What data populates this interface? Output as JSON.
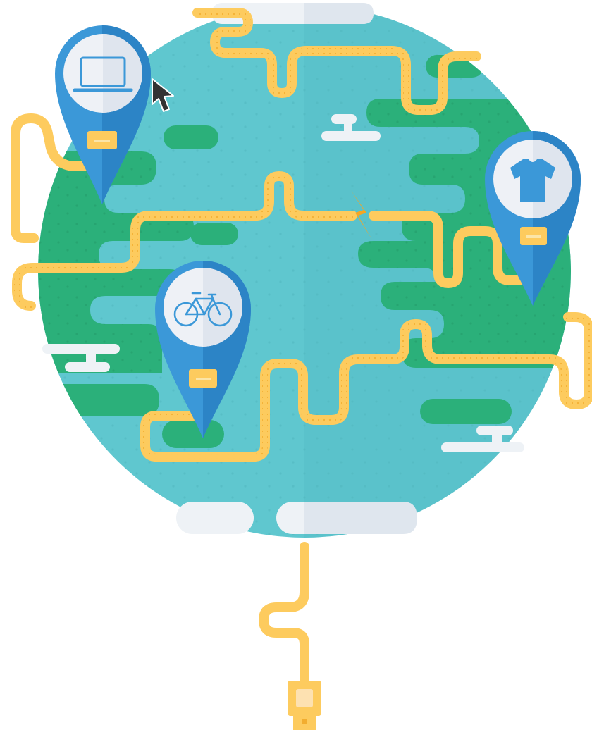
{
  "illustration": {
    "subject": "globe-connected-by-cable",
    "palette": {
      "ocean": "#5FC7CF",
      "ocean_dark": "#56BDC5",
      "land": "#2BB07A",
      "cable": "#FDCB5E",
      "cable_dots": "#F6B940",
      "pin_blue": "#3B98D8",
      "pin_blue_dark": "#2C84C6",
      "pin_face": "#EEF1F6",
      "cloud": "#EEF2F6",
      "spark": "#F5A623",
      "cursor": "#333333"
    },
    "pins": [
      {
        "icon": "laptop-icon"
      },
      {
        "icon": "tshirt-icon"
      },
      {
        "icon": "bicycle-icon"
      }
    ],
    "extras": [
      "cursor-arrow-icon",
      "lightning-spark-icon",
      "usb-plug-icon"
    ]
  }
}
